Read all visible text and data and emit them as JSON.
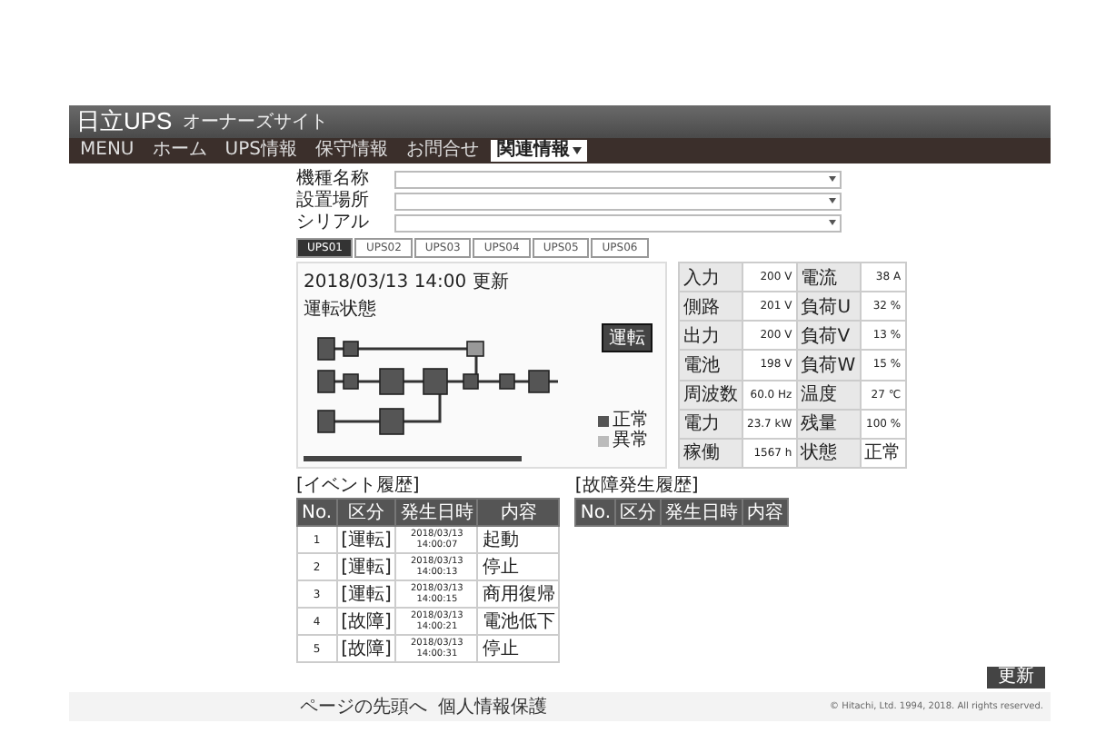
{
  "header": {
    "logo": "日立UPS",
    "subtitle": "オーナーズサイト"
  },
  "nav": [
    {
      "label": "MENU",
      "selected": false
    },
    {
      "label": "ホーム",
      "selected": false
    },
    {
      "label": "UPS情報",
      "selected": false
    },
    {
      "label": "保守情報",
      "selected": false
    },
    {
      "label": "お問合せ",
      "selected": false
    },
    {
      "label": "関連情報",
      "selected": true
    }
  ],
  "selectors": [
    {
      "label": "機種名称"
    },
    {
      "label": "設置場所"
    },
    {
      "label": "シリアル"
    }
  ],
  "tabs": [
    {
      "label": "UPS01",
      "selected": true
    },
    {
      "label": "UPS02",
      "selected": false
    },
    {
      "label": "UPS03",
      "selected": false
    },
    {
      "label": "UPS04",
      "selected": false
    },
    {
      "label": "UPS05",
      "selected": false
    },
    {
      "label": "UPS06",
      "selected": false
    }
  ],
  "status_panel": {
    "updated": "2018/03/13 14:00 更新",
    "caption": "運転状態",
    "badge": "運転",
    "legend": [
      {
        "label": "正常",
        "color": "#555555"
      },
      {
        "label": "異常",
        "color": "#bbbbbb"
      }
    ]
  },
  "measurements": [
    {
      "label": "入力",
      "value": "200 V",
      "label_2": "電流",
      "value_2": "38 A"
    },
    {
      "label": "側路",
      "value": "201 V",
      "label_2": "負荷U",
      "value_2": "32 %"
    },
    {
      "label": "出力",
      "value": "200 V",
      "label_2": "負荷V",
      "value_2": "13 %"
    },
    {
      "label": "電池",
      "value": "198 V",
      "label_2": "負荷W",
      "value_2": "15 %"
    },
    {
      "label": "周波数",
      "value": "60.0 Hz",
      "label_2": "温度",
      "value_2": "27 ℃"
    },
    {
      "label": "電力",
      "value": "23.7 kW",
      "label_2": "残量",
      "value_2": "100 %"
    },
    {
      "label": "稼働",
      "value": "1567 h",
      "label_2": "状態",
      "value_2": "正常"
    }
  ],
  "event_history": {
    "title": "[イベント履歴]",
    "columns": [
      "No.",
      "区分",
      "発生日時",
      "内容"
    ],
    "rows": [
      {
        "no": "1",
        "category": "[運転]",
        "date": "2018/03/13",
        "time": "14:00:07",
        "content": "起動"
      },
      {
        "no": "2",
        "category": "[運転]",
        "date": "2018/03/13",
        "time": "14:00:13",
        "content": "停止"
      },
      {
        "no": "3",
        "category": "[運転]",
        "date": "2018/03/13",
        "time": "14:00:15",
        "content": "商用復帰"
      },
      {
        "no": "4",
        "category": "[故障]",
        "date": "2018/03/13",
        "time": "14:00:21",
        "content": "電池低下"
      },
      {
        "no": "5",
        "category": "[故障]",
        "date": "2018/03/13",
        "time": "14:00:31",
        "content": "停止"
      }
    ]
  },
  "fault_history": {
    "title": "[故障発生履歴]",
    "columns": [
      "No.",
      "区分",
      "発生日時",
      "内容"
    ]
  },
  "update_button": "更新",
  "footer": {
    "links": [
      "ページの先頭へ",
      "個人情報保護"
    ],
    "copyright": "© Hitachi, Ltd. 1994, 2018. All rights reserved."
  }
}
